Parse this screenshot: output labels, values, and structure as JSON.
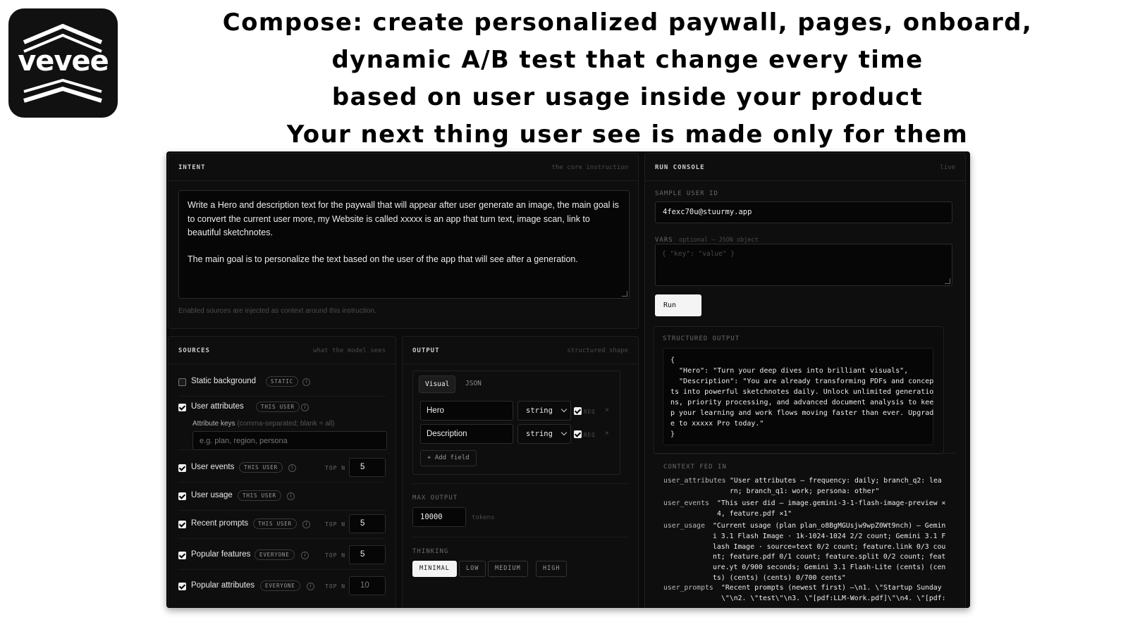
{
  "brand": {
    "logo_text": "vevee"
  },
  "headline": [
    "Compose: create personalized paywall, pages, onboard,",
    "dynamic A/B test that change every time",
    "based on user usage inside your product",
    "Your next thing user see is made only for them"
  ],
  "intent": {
    "title": "INTENT",
    "hint": "the core instruction",
    "paragraph1": "Write a Hero and description text for the paywall that will appear after user generate an image, the main goal is to convert the current user more, my Website is called xxxxx is an app that turn text, image scan, link to beautiful sketchnotes.",
    "paragraph2": "The main goal is to personalize the text based on the user of the app that will see after a generation.",
    "note": "Enabled sources are injected as context around this instruction."
  },
  "sources": {
    "title": "SOURCES",
    "hint": "what the model sees",
    "top_n_label": "TOP N",
    "attribute_keys_label": "Attribute keys",
    "attribute_keys_hint": "(comma-separated; blank = all)",
    "attribute_keys_placeholder": "e.g. plan, region, persona",
    "items": [
      {
        "label": "Static background",
        "badge": "STATIC",
        "checked": false
      },
      {
        "label": "User attributes",
        "badge": "THIS USER",
        "checked": true
      },
      {
        "label": "User events",
        "badge": "THIS USER",
        "checked": true,
        "top_n": "5"
      },
      {
        "label": "User usage",
        "badge": "THIS USER",
        "checked": true
      },
      {
        "label": "Recent prompts",
        "badge": "THIS USER",
        "checked": true,
        "top_n": "5"
      },
      {
        "label": "Popular features",
        "badge": "EVERYONE",
        "checked": true,
        "top_n": "5"
      },
      {
        "label": "Popular attributes",
        "badge": "EVERYONE",
        "checked": true,
        "top_n": "10"
      }
    ]
  },
  "output": {
    "title": "OUTPUT",
    "hint": "structured shape",
    "tabs": [
      "Visual",
      "JSON"
    ],
    "fields": [
      {
        "name": "Hero",
        "type": "string",
        "req": "REQ"
      },
      {
        "name": "Description",
        "type": "string",
        "req": "REQ"
      }
    ],
    "add_field": "+ Add field",
    "max_output_label": "MAX OUTPUT",
    "max_output_value": "10000",
    "max_output_unit": "tokens",
    "thinking_label": "THINKING",
    "thinking_options": [
      "MINIMAL",
      "LOW",
      "MEDIUM",
      "HIGH"
    ],
    "thinking_selected": "MINIMAL"
  },
  "console": {
    "title": "RUN CONSOLE",
    "hint": "live",
    "sample_user_label": "SAMPLE USER ID",
    "sample_user_value": "4fexc70u@stuurmy.app",
    "vars_label": "VARS",
    "vars_hint": "optional — JSON object",
    "vars_placeholder": "{ \"key\": \"value\" }",
    "run_label": "Run",
    "structured_label": "STRUCTURED OUTPUT",
    "structured_text": "{\n  \"Hero\": \"Turn your deep dives into brilliant visuals\",\n  \"Description\": \"You are already transforming PDFs and concep\nts into powerful sketchnotes daily. Unlock unlimited generatio\nns, priority processing, and advanced document analysis to kee\np your learning and work flows moving faster than ever. Upgrad\ne to xxxxx Pro today.\"\n}",
    "context_label": "CONTEXT FED IN",
    "context": [
      {
        "key": "user_attributes",
        "value": "\"User attributes — frequency: daily; branch_q2: lea\nrn; branch_q1: work; persona: other\""
      },
      {
        "key": "user_events",
        "value": "\"This user did — image.gemini-3-1-flash-image-preview ×\n4, feature.pdf ×1\""
      },
      {
        "key": "user_usage",
        "value": "\"Current usage (plan plan_o8BgMGUsjw9wpZ0Wt9nch) — Gemin\ni 3.1 Flash Image · 1k-1024-1024 2/2 count; Gemini 3.1 F\nlash Image · source=text 0/2 count; feature.link 0/3 cou\nnt; feature.pdf 0/1 count; feature.split 0/2 count; feat\nure.yt 0/900 seconds; Gemini 3.1 Flash-Lite (cents) (cen\nts) (cents) (cents) 0/700 cents\""
      },
      {
        "key": "user_prompts",
        "value": "\"Recent prompts (newest first) —\\n1. \\\"Startup Sunday\n\\\"\\n2. \\\"test\\\"\\n3. \\\"[pdf:LLM-Work.pdf]\\\"\\n4. \\\"[pdf:"
      }
    ]
  }
}
